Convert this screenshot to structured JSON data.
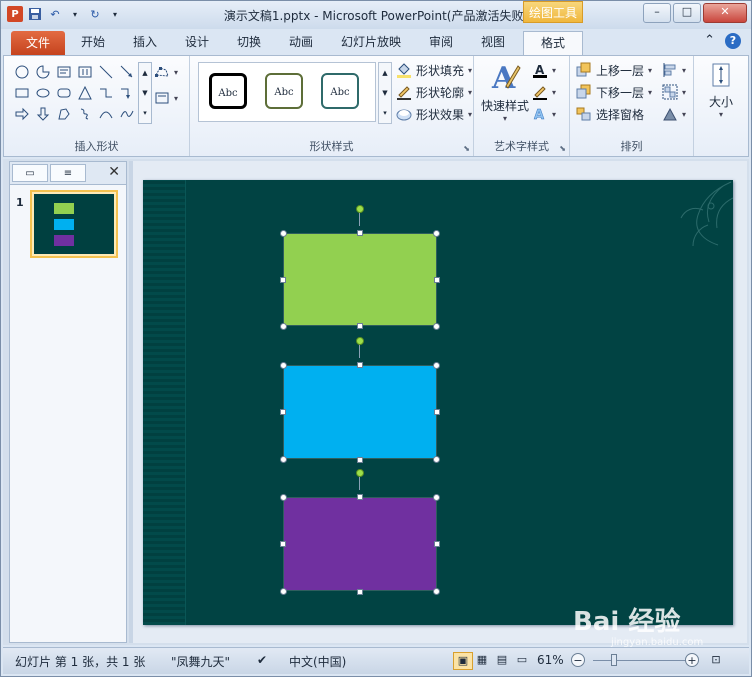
{
  "window": {
    "title": "演示文稿1.pptx  -  Microsoft PowerPoint(产品激活失败)",
    "context_tab_header": "绘图工具",
    "buttons": {
      "minimize": "–",
      "restore": "□",
      "close": "✕"
    }
  },
  "tabs": {
    "file": "文件",
    "items": [
      "开始",
      "插入",
      "设计",
      "切换",
      "动画",
      "幻灯片放映",
      "审阅",
      "视图"
    ],
    "active": "格式"
  },
  "ribbon": {
    "insert_shapes": {
      "label": "插入形状"
    },
    "shape_styles": {
      "label": "形状样式",
      "gallery": [
        "Abc",
        "Abc",
        "Abc"
      ],
      "fill": "形状填充",
      "outline": "形状轮廓",
      "effects": "形状效果"
    },
    "wordart": {
      "label": "艺术字样式",
      "quick_styles": "快速样式"
    },
    "arrange": {
      "label": "排列",
      "bring_forward": "上移一层",
      "send_backward": "下移一层",
      "selection_pane": "选择窗格"
    },
    "size": {
      "label": "大小"
    }
  },
  "thumbnails": {
    "slide_number": "1"
  },
  "slide": {
    "shapes": [
      {
        "name": "green-rectangle",
        "fill": "#92d050"
      },
      {
        "name": "blue-rectangle",
        "fill": "#00b0f0"
      },
      {
        "name": "purple-rectangle",
        "fill": "#7030a0"
      }
    ],
    "background": "#014343"
  },
  "status": {
    "slide_info": "幻灯片 第 1 张，共 1 张",
    "theme": "\"凤舞九天\"",
    "language": "中文(中国)",
    "zoom": "61%"
  },
  "watermark": {
    "text": "Bai 经验",
    "sub": "jingyan.baidu.com"
  }
}
